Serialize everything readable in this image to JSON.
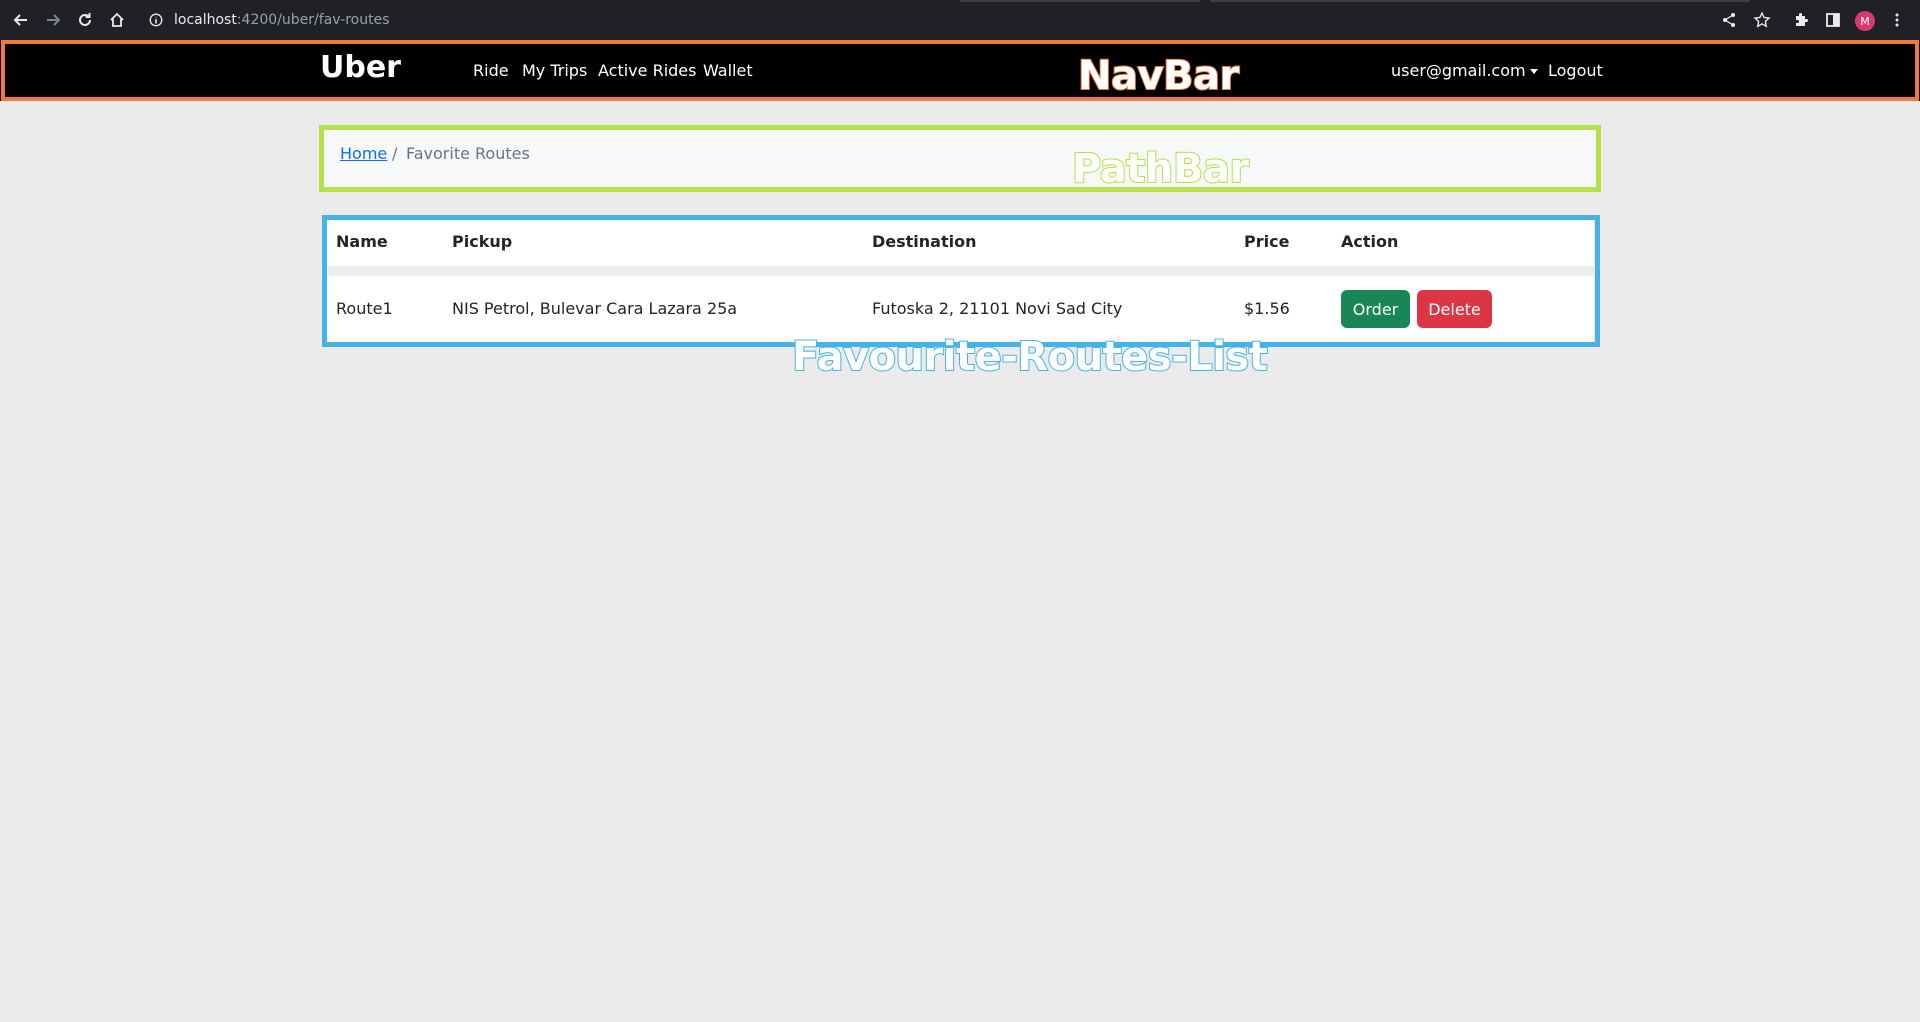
{
  "browser": {
    "url_host": "localhost",
    "url_path": ":4200/uber/fav-routes",
    "profile_initial": "M"
  },
  "navbar": {
    "brand": "Uber",
    "links": [
      "Ride",
      "My Trips",
      "Active Rides",
      "Wallet"
    ],
    "user": "user@gmail.com",
    "logout": "Logout"
  },
  "breadcrumb": {
    "home": "Home",
    "separator": "/",
    "current": "Favorite Routes"
  },
  "table": {
    "headers": [
      "Name",
      "Pickup",
      "Destination",
      "Price",
      "Action"
    ],
    "rows": [
      {
        "name": "Route1",
        "pickup": "NIS Petrol, Bulevar Cara Lazara 25a",
        "destination": "Futoska 2, 21101 Novi Sad City",
        "price": "$1.56",
        "order_label": "Order",
        "delete_label": "Delete"
      }
    ]
  },
  "annotations": {
    "navbar": "NavBar",
    "pathbar": "PathBar",
    "list": "Favourite-Routes-List"
  },
  "colors": {
    "navbar_annotation": "#f07a3a",
    "pathbar_annotation": "#b5e04a",
    "list_annotation": "#45b3e8",
    "order_button": "#198754",
    "delete_button": "#dc3545",
    "link": "#0d6efd"
  }
}
